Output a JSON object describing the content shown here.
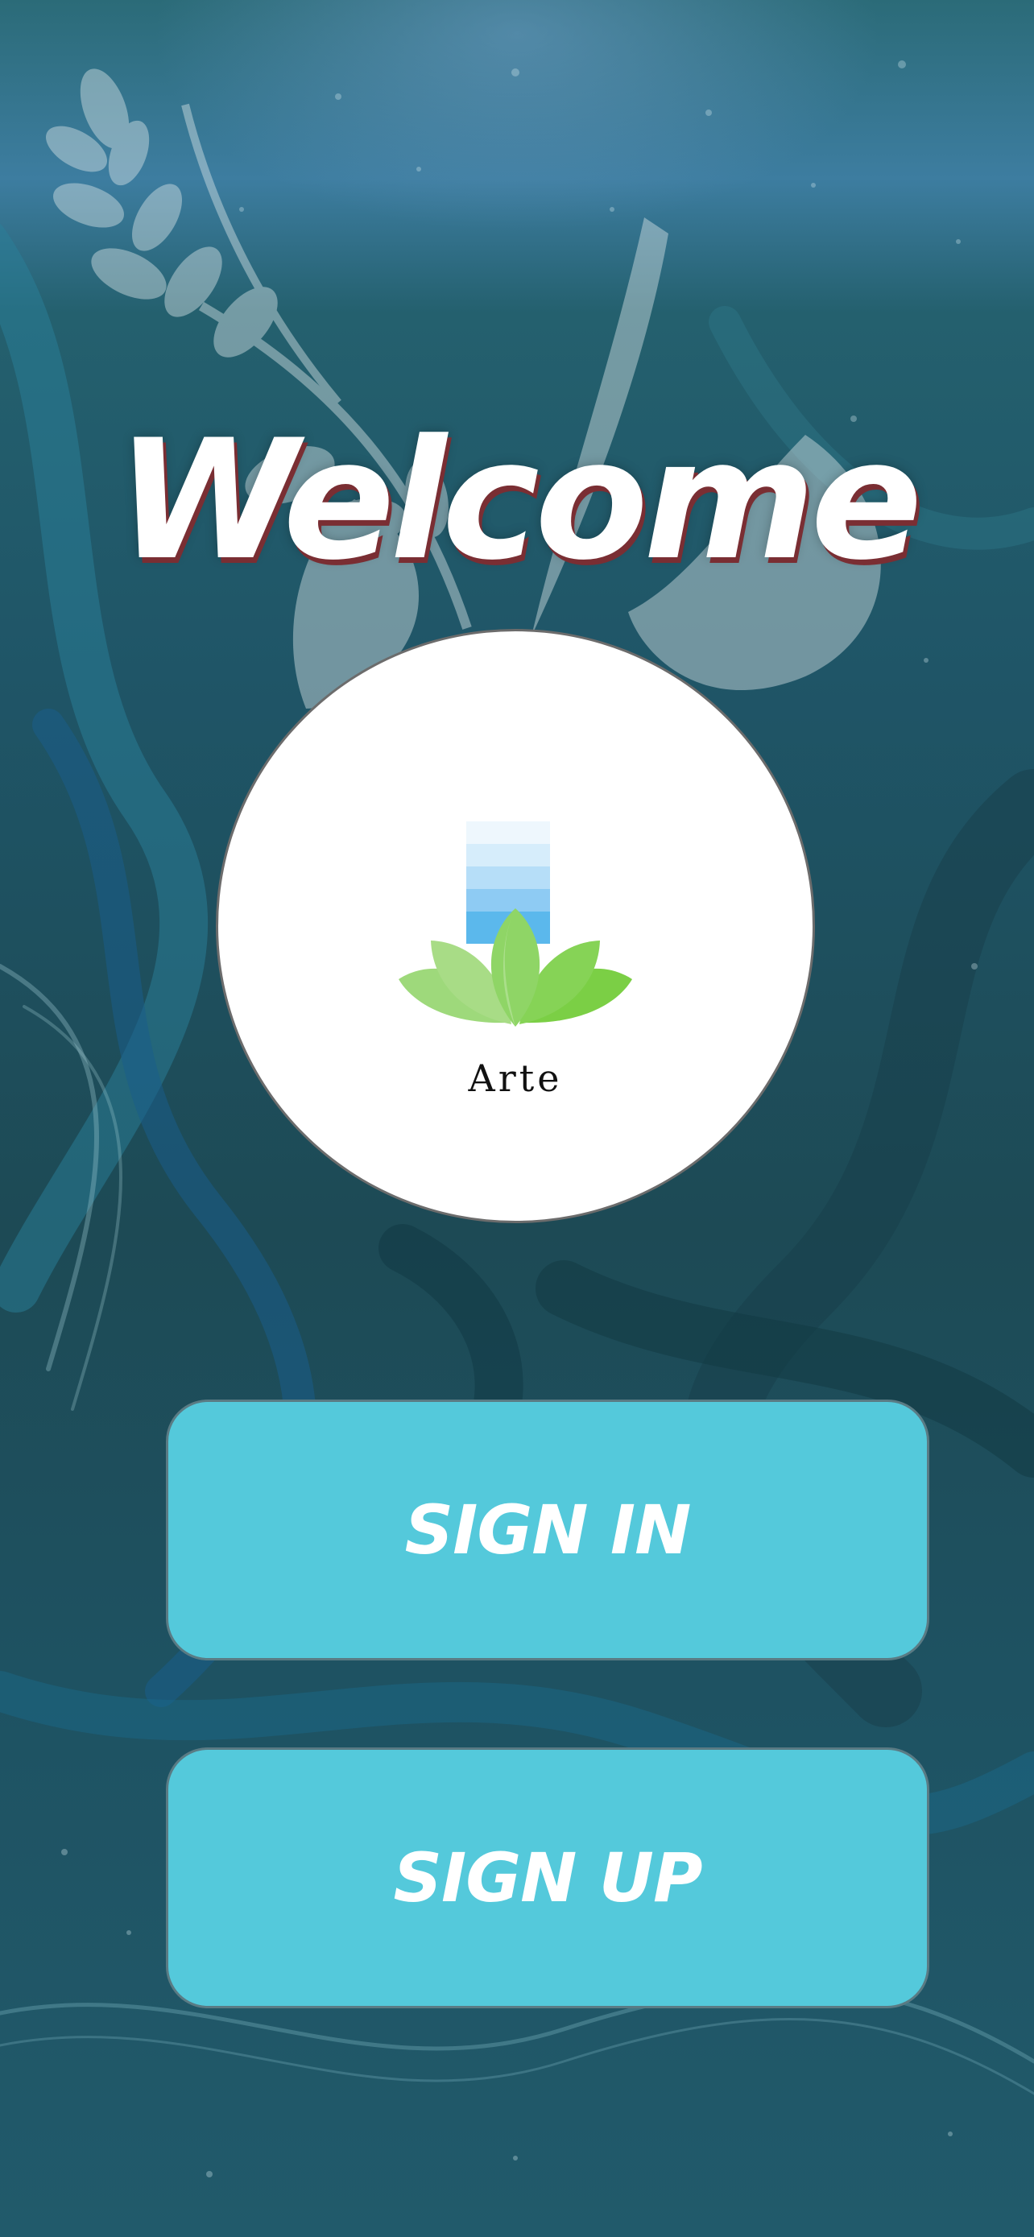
{
  "welcome": {
    "title": "Welcome"
  },
  "logo": {
    "name": "Arte",
    "icon": "lotus-icon"
  },
  "actions": {
    "sign_in_label": "SIGN IN",
    "sign_up_label": "SIGN UP"
  },
  "colors": {
    "background": "#1f4f5c",
    "button": "#54c9db",
    "button_text": "#ffffff",
    "title_shadow": "#7a2e33",
    "lotus_light": "#9ed97b",
    "lotus_dark": "#7bcf45",
    "water_blue": "#5bb8ec"
  }
}
